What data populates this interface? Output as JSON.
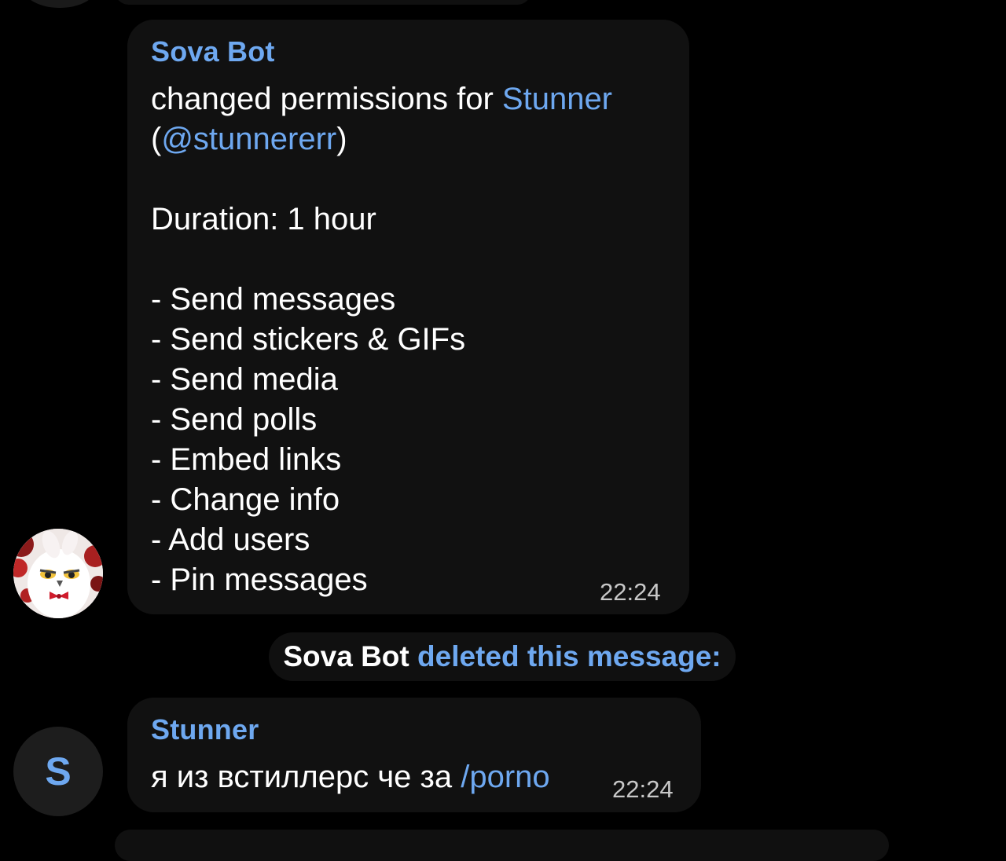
{
  "colors": {
    "background": "#000000",
    "bubble": "#111111",
    "accent_link": "#6ea8f0",
    "text": "#ffffff",
    "timestamp": "#c8c8c8"
  },
  "messages": [
    {
      "sender": "Sova Bot",
      "avatar_icon": "owl-avatar",
      "text_line1_prefix": "changed permissions for ",
      "mention_name": "Stunner",
      "text_line2_open": "(",
      "mention_username": "@stunnererr",
      "text_line2_close": ")",
      "duration": "Duration: 1 hour",
      "permissions": [
        "- Send messages",
        "- Send stickers & GIFs",
        "- Send media",
        "- Send polls",
        "- Embed links",
        "- Change info",
        "- Add users",
        "- Pin messages"
      ],
      "time": "22:24"
    },
    {
      "sender": "Stunner",
      "avatar_letter": "S",
      "text_prefix": "я из встиллерс че за ",
      "command": "/porno",
      "time": "22:24"
    }
  ],
  "service": {
    "actor": "Sova Bot",
    "action": " deleted this message:"
  }
}
